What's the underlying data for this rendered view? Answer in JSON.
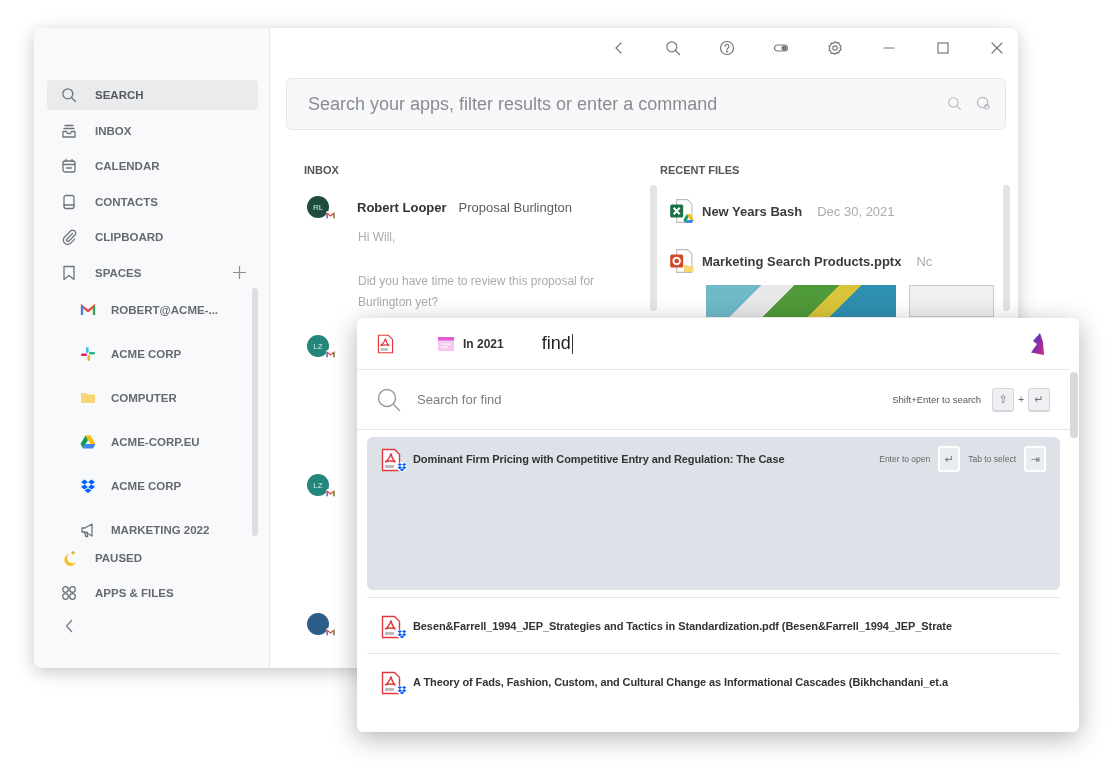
{
  "sidebar": {
    "items": [
      {
        "label": "SEARCH",
        "selected": true
      },
      {
        "label": "INBOX",
        "selected": false
      },
      {
        "label": "CALENDAR",
        "selected": false
      },
      {
        "label": "CONTACTS",
        "selected": false
      },
      {
        "label": "CLIPBOARD",
        "selected": false
      },
      {
        "label": "SPACES",
        "selected": false
      }
    ],
    "spaces": [
      {
        "label": "ROBERT@ACME-...",
        "selected": false
      },
      {
        "label": "ACME CORP",
        "selected": false
      },
      {
        "label": "COMPUTER",
        "selected": false
      },
      {
        "label": "ACME-CORP.EU",
        "selected": false
      },
      {
        "label": "ACME CORP",
        "selected": false
      },
      {
        "label": "MARKETING 2022",
        "selected": false
      }
    ],
    "bottom_items": [
      {
        "label": "PAUSED",
        "selected": false
      },
      {
        "label": "APPS & FILES",
        "selected": false
      }
    ]
  },
  "search_bar": {
    "placeholder": "Search your apps, filter results or enter a command"
  },
  "inbox": {
    "title": "INBOX",
    "messages": [
      {
        "initials": "RL",
        "color": "#1e4d40",
        "sender": "Robert Looper",
        "subject": "Proposal Burlington",
        "preview": [
          "Hi Will,",
          "Did you have time to review this proposal for Burlington yet?"
        ]
      },
      {
        "initials": "LZ",
        "color": "#23867a"
      },
      {
        "initials": "LZ",
        "color": "#23867a"
      },
      {
        "color": "#2f5d8a"
      }
    ]
  },
  "recent_files": {
    "title": "RECENT FILES",
    "files": [
      {
        "name": "New Years Bash",
        "date": "Dec 30, 2021"
      },
      {
        "name": "Marketing Search Products.pptx",
        "date": "Nc"
      }
    ]
  },
  "launcher": {
    "filters": [
      {
        "kind": "pdf"
      },
      {
        "kind": "date",
        "label": "In 2021"
      }
    ],
    "query": "find",
    "suggestion": {
      "text": "Search for find",
      "hint": "Shift+Enter to search",
      "keys": [
        "⇧",
        "↵"
      ],
      "joiner": "+"
    },
    "results": [
      {
        "title": "Dominant Firm Pricing with Competitive Entry and Regulation: The Case",
        "selected": true
      },
      {
        "title": "Besen&Farrell_1994_JEP_Strategies and Tactics in Standardization.pdf (Besen&Farrell_1994_JEP_Strate",
        "selected": false
      },
      {
        "title": "A Theory of Fads, Fashion, Custom, and Cultural Change as Informational Cascades (Bikhchandani_et.a",
        "selected": false
      }
    ],
    "actions": [
      {
        "hint": "Enter to open",
        "key": "↵"
      },
      {
        "hint": "Tab to select",
        "key": "⇥"
      }
    ]
  }
}
